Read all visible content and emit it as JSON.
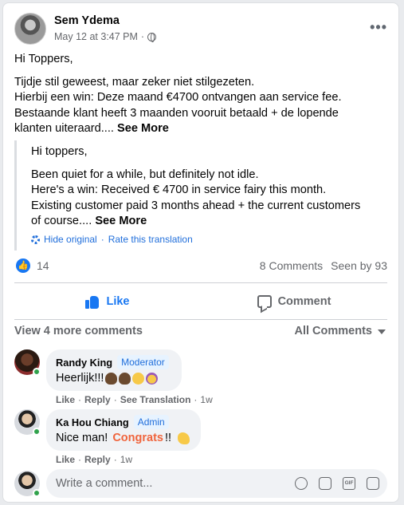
{
  "post": {
    "author": "Sem Ydema",
    "timestamp": "May 12 at 3:47 PM",
    "separator": "·",
    "audience_icon": "globe-icon",
    "more_icon": "•••",
    "original_lines": [
      "Hi Toppers,",
      "Tijdje stil geweest, maar zeker niet stilgezeten.",
      "Hierbij een win: Deze maand €4700 ontvangen aan service fee.",
      "Bestaande klant heeft 3 maanden vooruit betaald + de lopende",
      "klanten uiteraard...."
    ],
    "see_more": "See More"
  },
  "translation": {
    "lines": [
      "Hi toppers,",
      "Been quiet for a while, but definitely not idle.",
      "Here's a win: Received € 4700 in service fairy this month.",
      "Existing customer paid 3 months ahead + the current customers",
      "of course...."
    ],
    "see_more": "See More",
    "hide_original": "Hide original",
    "link_separator": "·",
    "rate": "Rate this translation"
  },
  "stats": {
    "like_count": "14",
    "comments": "8 Comments",
    "seen_by": "Seen by 93"
  },
  "actions": {
    "like": "Like",
    "comment": "Comment"
  },
  "comments_header": {
    "view_more": "View 4 more comments",
    "filter": "All Comments"
  },
  "comments": [
    {
      "name": "Randy King",
      "role": "Moderator",
      "text": "Heerlijk!!!",
      "actions": [
        "Like",
        "Reply",
        "See Translation",
        "1w"
      ]
    },
    {
      "name": "Ka Hou Chiang",
      "role": "Admin",
      "text_before": "Nice man! ",
      "text_highlight": "Congrats",
      "text_after": "!!",
      "actions": [
        "Like",
        "Reply",
        "1w"
      ]
    }
  ],
  "composer": {
    "placeholder": "Write a comment...",
    "icons": [
      "emoji-icon",
      "camera-icon",
      "gif-icon",
      "sticker-icon"
    ],
    "gif_label": "GIF"
  },
  "colors": {
    "accent": "#1877f2",
    "link": "#216fdb",
    "muted": "#65676b",
    "online": "#31a24c",
    "highlight": "#f0643c"
  }
}
